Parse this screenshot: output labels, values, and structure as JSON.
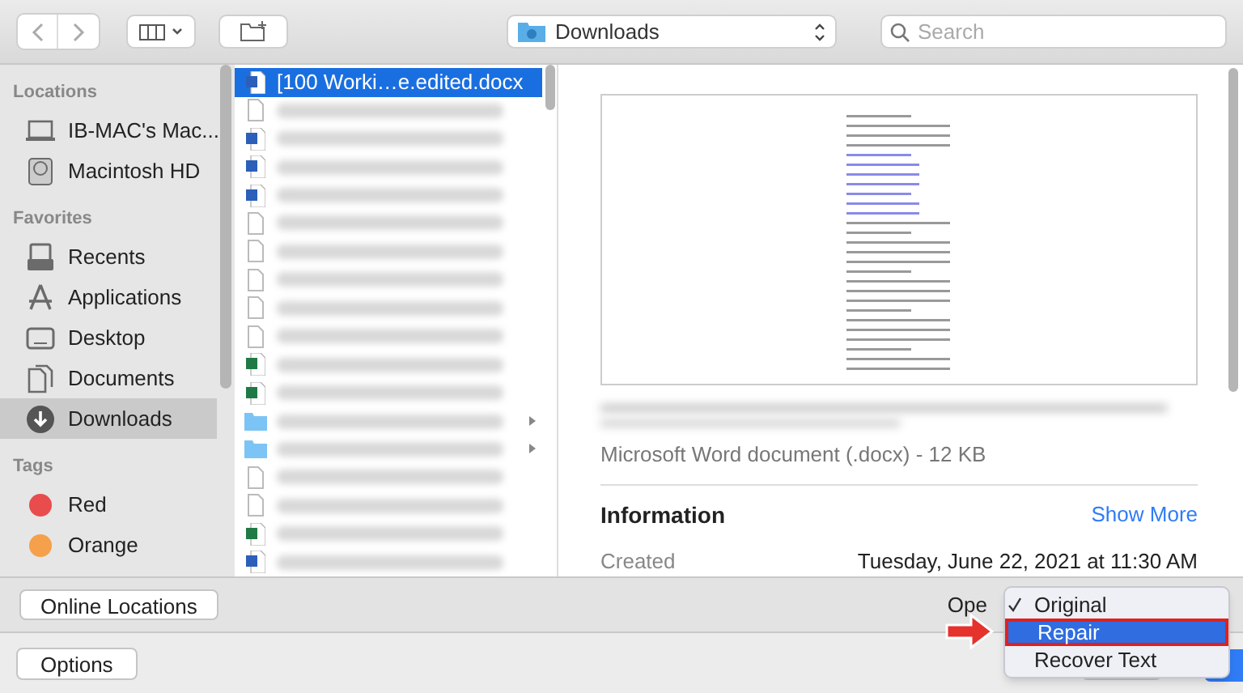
{
  "toolbar": {
    "location": "Downloads",
    "search": {
      "placeholder": "Search"
    }
  },
  "sidebar": [
    {
      "heading": "Locations",
      "items": [
        {
          "label": "IB-MAC's Mac...",
          "kind": "laptop",
          "selected": false
        },
        {
          "label": "Macintosh HD",
          "kind": "disk",
          "selected": false
        }
      ]
    },
    {
      "heading": "Favorites",
      "items": [
        {
          "label": "Recents",
          "kind": "recents",
          "selected": false
        },
        {
          "label": "Applications",
          "kind": "apps",
          "selected": false
        },
        {
          "label": "Desktop",
          "kind": "desktop",
          "selected": false
        },
        {
          "label": "Documents",
          "kind": "documents",
          "selected": false
        },
        {
          "label": "Downloads",
          "kind": "downloads",
          "selected": true
        }
      ]
    },
    {
      "heading": "Tags",
      "items": [
        {
          "label": "Red",
          "kind": "tag",
          "color": "#e84c4c",
          "selected": false
        },
        {
          "label": "Orange",
          "kind": "tag",
          "color": "#f5a04a",
          "selected": false
        }
      ]
    }
  ],
  "files": [
    {
      "name": "[100 Worki…e.edited.docx",
      "kind": "word",
      "selected": true
    },
    {
      "kind": "blank",
      "selected": false
    },
    {
      "kind": "word",
      "selected": false
    },
    {
      "kind": "word",
      "selected": false
    },
    {
      "kind": "word",
      "selected": false
    },
    {
      "kind": "blank",
      "selected": false
    },
    {
      "kind": "blank",
      "selected": false
    },
    {
      "kind": "blank",
      "selected": false
    },
    {
      "kind": "blank",
      "selected": false
    },
    {
      "kind": "blank",
      "selected": false
    },
    {
      "kind": "excel",
      "selected": false
    },
    {
      "kind": "excel",
      "selected": false
    },
    {
      "kind": "folder",
      "selected": false
    },
    {
      "kind": "folder",
      "selected": false
    },
    {
      "kind": "blank",
      "selected": false
    },
    {
      "kind": "blank",
      "selected": false
    },
    {
      "kind": "excel",
      "selected": false
    },
    {
      "kind": "word",
      "selected": false
    }
  ],
  "preview": {
    "file_type": "Microsoft Word document (.docx) - 12 KB",
    "info_heading": "Information",
    "show_more": "Show More",
    "created_label": "Created",
    "created_value": "Tuesday, June 22, 2021 at 11:30 AM"
  },
  "online_locations": "Online Locations",
  "options": "Options",
  "open_label": "Ope",
  "open_menu": [
    {
      "label": "Original",
      "checked": true,
      "selected": false
    },
    {
      "label": "Repair",
      "checked": false,
      "selected": true
    },
    {
      "label": "Recover Text",
      "checked": false,
      "selected": false
    }
  ]
}
